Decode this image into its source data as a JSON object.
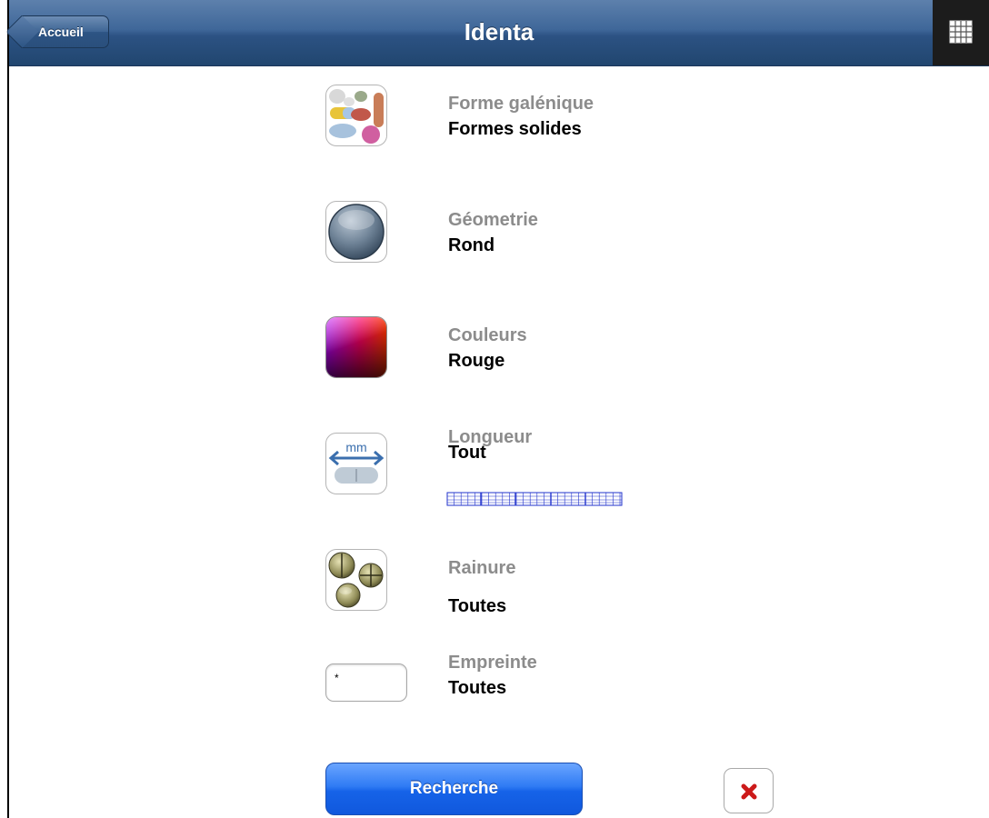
{
  "navbar": {
    "back_label": "Accueil",
    "title": "Identa",
    "grid_icon": "grid-icon"
  },
  "criteria": [
    {
      "icon": "pills-forms-icon",
      "label": "Forme galénique",
      "value": "Formes solides"
    },
    {
      "icon": "round-shape-icon",
      "label": "Géometrie",
      "value": "Rond"
    },
    {
      "icon": "color-gradient-icon",
      "label": "Couleurs",
      "value": "Rouge"
    },
    {
      "icon": "length-mm-icon",
      "label": "Longueur",
      "value": "Tout",
      "ruler_label_icon": "length-ruler-icon"
    },
    {
      "icon": "score-line-icon",
      "label": "Rainure",
      "value": "Toutes"
    },
    {
      "label": "Empreinte",
      "value": "Toutes",
      "input_value": "*"
    }
  ],
  "actions": {
    "search_label": "Recherche",
    "clear_icon": "close-x-icon"
  },
  "colors": {
    "navbar": "#2c5283",
    "search_button": "#1663e8",
    "clear_icon": "#cc1a1a",
    "label_gray": "#8c8c8c"
  }
}
